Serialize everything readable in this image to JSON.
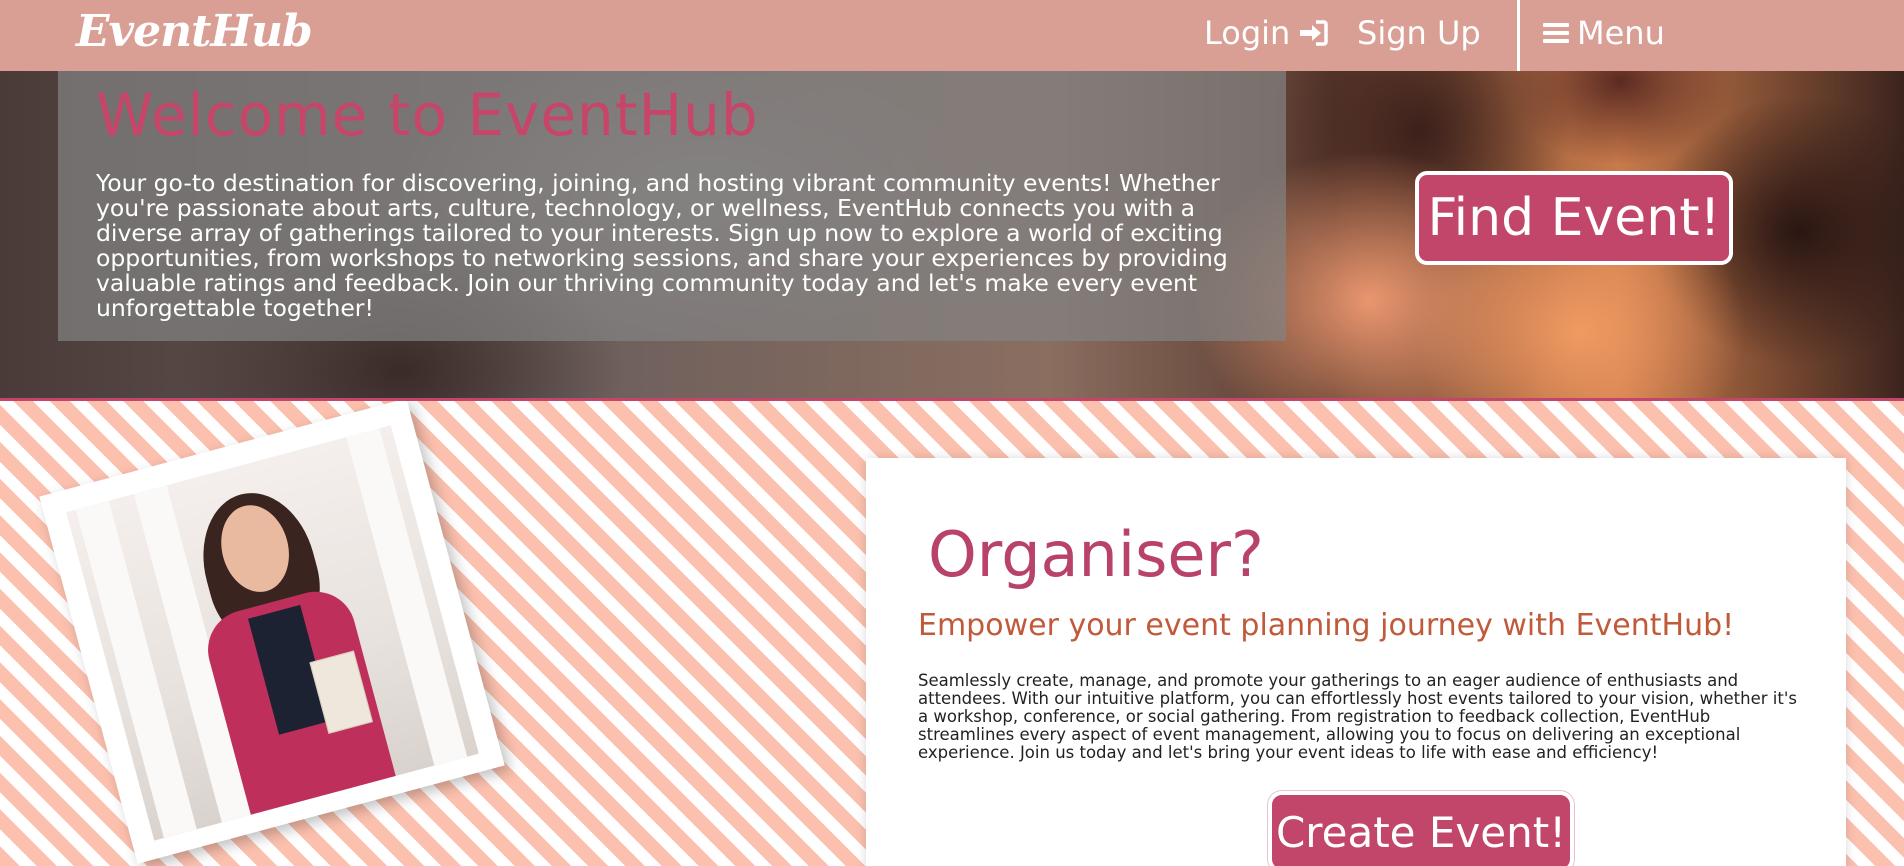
{
  "nav": {
    "brand": "EventHub",
    "login_label": "Login",
    "login_icon": "sign-in-icon",
    "signup_label": "Sign Up",
    "menu_label": "Menu",
    "menu_icon": "hamburger-icon"
  },
  "hero": {
    "title": "Welcome to EventHub",
    "text": "Your go-to destination for discovering, joining, and hosting vibrant community events! Whether you're passionate about arts, culture, technology, or wellness, EventHub connects you with a diverse array of gatherings tailored to your interests. Sign up now to explore a world of exciting opportunities, from workshops to networking sessions, and share your experiences by providing valuable ratings and feedback. Join our thriving community today and let's make every event unforgettable together!",
    "find_button": "Find Event!"
  },
  "organiser": {
    "title": "Organiser?",
    "subtitle": "Empower your event planning journey with EventHub!",
    "text": "Seamlessly create, manage, and promote your gatherings to an eager audience of enthusiasts and attendees. With our intuitive platform, you can effortlessly host events tailored to your vision, whether it's a workshop, conference, or social gathering. From registration to feedback collection, EventHub streamlines every aspect of event management, allowing you to focus on delivering an exceptional experience. Join us today and let's bring your event ideas to life with ease and efficiency!",
    "create_button": "Create Event!"
  },
  "colors": {
    "nav_bg": "#d99e94",
    "accent": "#c2456a",
    "subtitle": "#c15a3b"
  }
}
